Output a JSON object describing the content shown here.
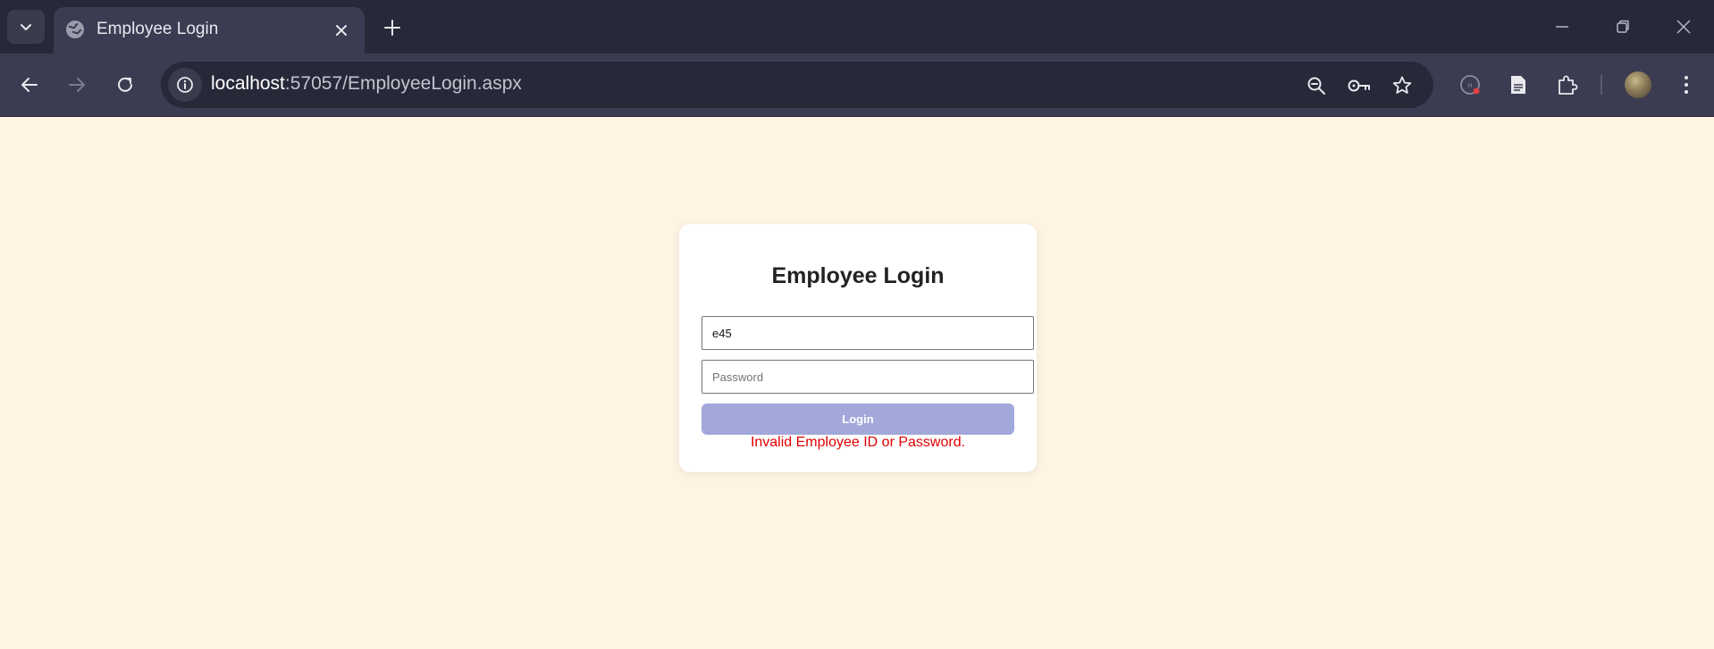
{
  "browser": {
    "tab": {
      "title": "Employee Login"
    },
    "address_bar": {
      "host": "localhost",
      "path": ":57057/EmployeeLogin.aspx"
    },
    "icons": [
      "tab-search-icon",
      "globe-icon",
      "close-icon",
      "plus-icon",
      "minimize-icon",
      "restore-icon",
      "close-window-icon",
      "back-arrow-icon",
      "forward-arrow-icon",
      "reload-icon",
      "site-info-icon",
      "zoom-out-icon",
      "key-icon",
      "star-icon",
      "extension-badge-icon",
      "document-icon",
      "puzzle-icon",
      "avatar",
      "kebab-menu-icon"
    ]
  },
  "login": {
    "title": "Employee Login",
    "employee_id_value": "e45",
    "password_placeholder": "Password",
    "login_label": "Login",
    "error": "Invalid Employee ID or Password."
  },
  "colors": {
    "page_bg": "#fff3e3",
    "button_bg": "#a2a8da",
    "error": "#e00000",
    "chrome_dark": "#272838",
    "chrome_mid": "#3b3c51"
  }
}
